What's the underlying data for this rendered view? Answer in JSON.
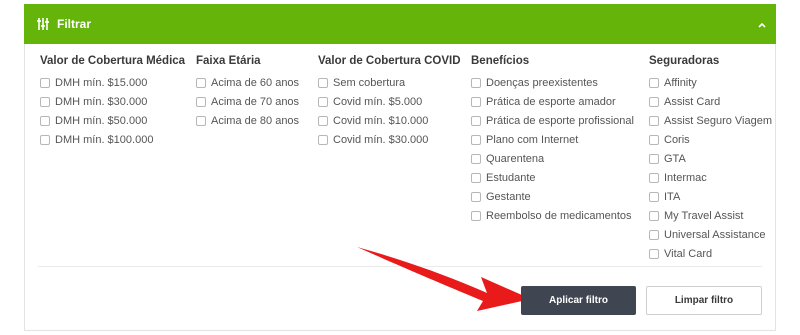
{
  "header": {
    "title": "Filtrar",
    "icon": "sliders-icon",
    "toggle_icon": "chevron-up-icon",
    "color": "#64b40a"
  },
  "columns": [
    {
      "title": "Valor de Cobertura Médica",
      "options": [
        "DMH mín. $15.000",
        "DMH mín. $30.000",
        "DMH mín. $50.000",
        "DMH mín. $100.000"
      ]
    },
    {
      "title": "Faixa Etária",
      "options": [
        "Acima de 60 anos",
        "Acima de 70 anos",
        "Acima de 80 anos"
      ]
    },
    {
      "title": "Valor de Cobertura COVID",
      "options": [
        "Sem cobertura",
        "Covid mín. $5.000",
        "Covid mín. $10.000",
        "Covid mín. $30.000"
      ]
    },
    {
      "title": "Benefícios",
      "options": [
        "Doenças preexistentes",
        "Prática de esporte amador",
        "Prática de esporte profissional",
        "Plano com Internet",
        "Quarentena",
        "Estudante",
        "Gestante",
        "Reembolso de medicamentos"
      ]
    },
    {
      "title": "Seguradoras",
      "options": [
        "Affinity",
        "Assist Card",
        "Assist Seguro Viagem",
        "Coris",
        "GTA",
        "Intermac",
        "ITA",
        "My Travel Assist",
        "Universal Assistance",
        "Vital Card"
      ]
    }
  ],
  "buttons": {
    "apply": "Aplicar filtro",
    "clear": "Limpar filtro"
  },
  "colors": {
    "apply_bg": "#3f4652",
    "arrow": "#e81a1a"
  }
}
